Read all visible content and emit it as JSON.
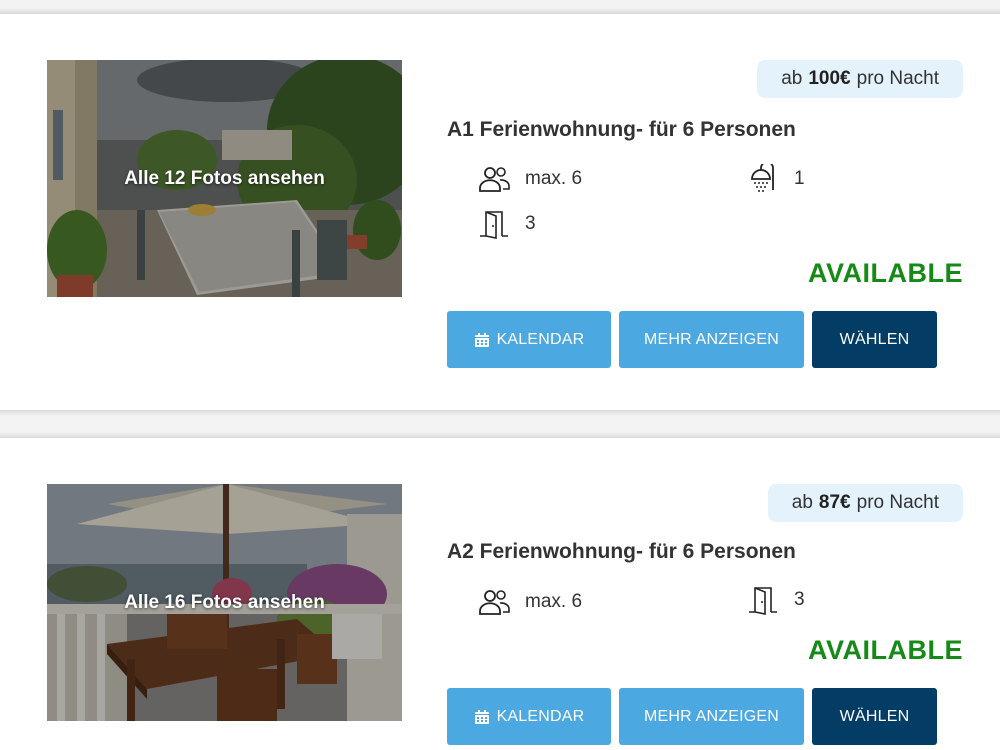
{
  "listings": [
    {
      "photos_caption": "Alle 12 Fotos ansehen",
      "price": {
        "prefix": "ab",
        "amount": "100€",
        "suffix": "pro Nacht"
      },
      "title": "A1 Ferienwohnung- für 6 Personen",
      "features": {
        "guests": "max. 6",
        "bathrooms": "1",
        "rooms": "3"
      },
      "status": "AVAILABLE",
      "buttons": {
        "calendar": "KALENDAR",
        "more": "MEHR ANZEIGEN",
        "select": "WÄHLEN"
      }
    },
    {
      "photos_caption": "Alle 16 Fotos ansehen",
      "price": {
        "prefix": "ab",
        "amount": "87€",
        "suffix": "pro Nacht"
      },
      "title": "A2 Ferienwohnung- für 6 Personen",
      "features": {
        "guests": "max. 6",
        "rooms": "3"
      },
      "status": "AVAILABLE",
      "buttons": {
        "calendar": "KALENDAR",
        "more": "MEHR ANZEIGEN",
        "select": "WÄHLEN"
      }
    }
  ],
  "colors": {
    "accent_light": "#4ba8e0",
    "accent_dark": "#033d66",
    "available_green": "#168a16",
    "price_pill_bg": "#e4f2fb"
  },
  "icons": [
    "users-icon",
    "shower-icon",
    "door-icon",
    "calendar-icon"
  ]
}
